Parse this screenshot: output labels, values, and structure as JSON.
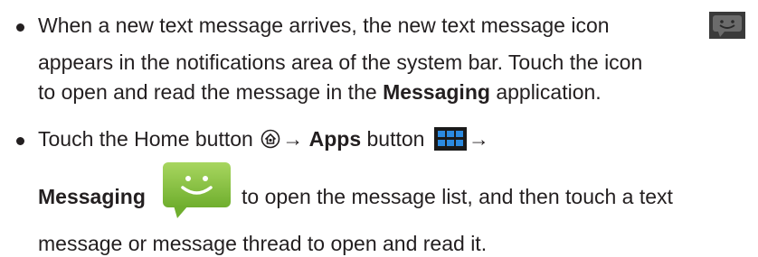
{
  "bullets": [
    {
      "lines": [
        {
          "text": "When a new text message arrives, the new text message icon"
        },
        {
          "text": "appears in the notifications area of the system bar. Touch the icon"
        },
        {
          "before": "to open and read the message in the ",
          "bold": "Messaging",
          "after": " application."
        }
      ]
    },
    {
      "line1": {
        "text1": "Touch the Home button ",
        "arrow1": "→",
        "bold": "Apps",
        "text2": " button",
        "arrow2": "→"
      },
      "line2": {
        "bold": "Messaging",
        "after": " to open the message list, and then touch a text"
      },
      "line3": {
        "text": "message or message thread to open and read it."
      }
    }
  ],
  "icons": {
    "status_bar_message": "new-text-message-status-icon",
    "home": "home-button-icon",
    "apps": "apps-grid-icon",
    "messaging": "messaging-app-icon"
  },
  "colors": {
    "text": "#231f20",
    "messaging_green": "#8bc541",
    "apps_blue": "#2b8ae0"
  }
}
